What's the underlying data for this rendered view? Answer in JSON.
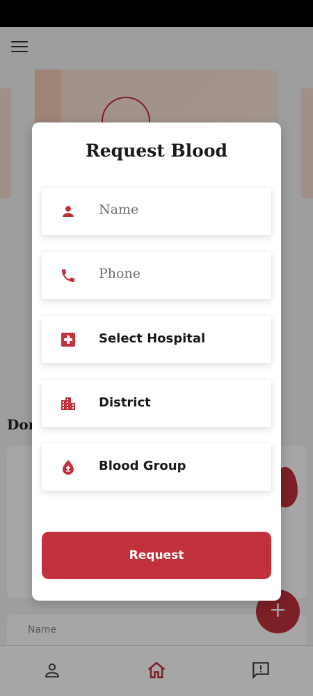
{
  "modal": {
    "title": "Request Blood",
    "fields": {
      "name": {
        "placeholder": "Name",
        "icon": "person-icon"
      },
      "phone": {
        "placeholder": "Phone",
        "icon": "phone-icon"
      },
      "hospital": {
        "value": "Select Hospital",
        "icon": "hospital-icon"
      },
      "district": {
        "value": "District",
        "icon": "city-icon"
      },
      "blood_group": {
        "value": "Blood Group",
        "icon": "blood-drop-icon"
      }
    },
    "request_label": "Request"
  },
  "background": {
    "section_title": "Don",
    "fab_label": "+",
    "card2_label": "Name"
  },
  "colors": {
    "accent": "#c0313b"
  }
}
